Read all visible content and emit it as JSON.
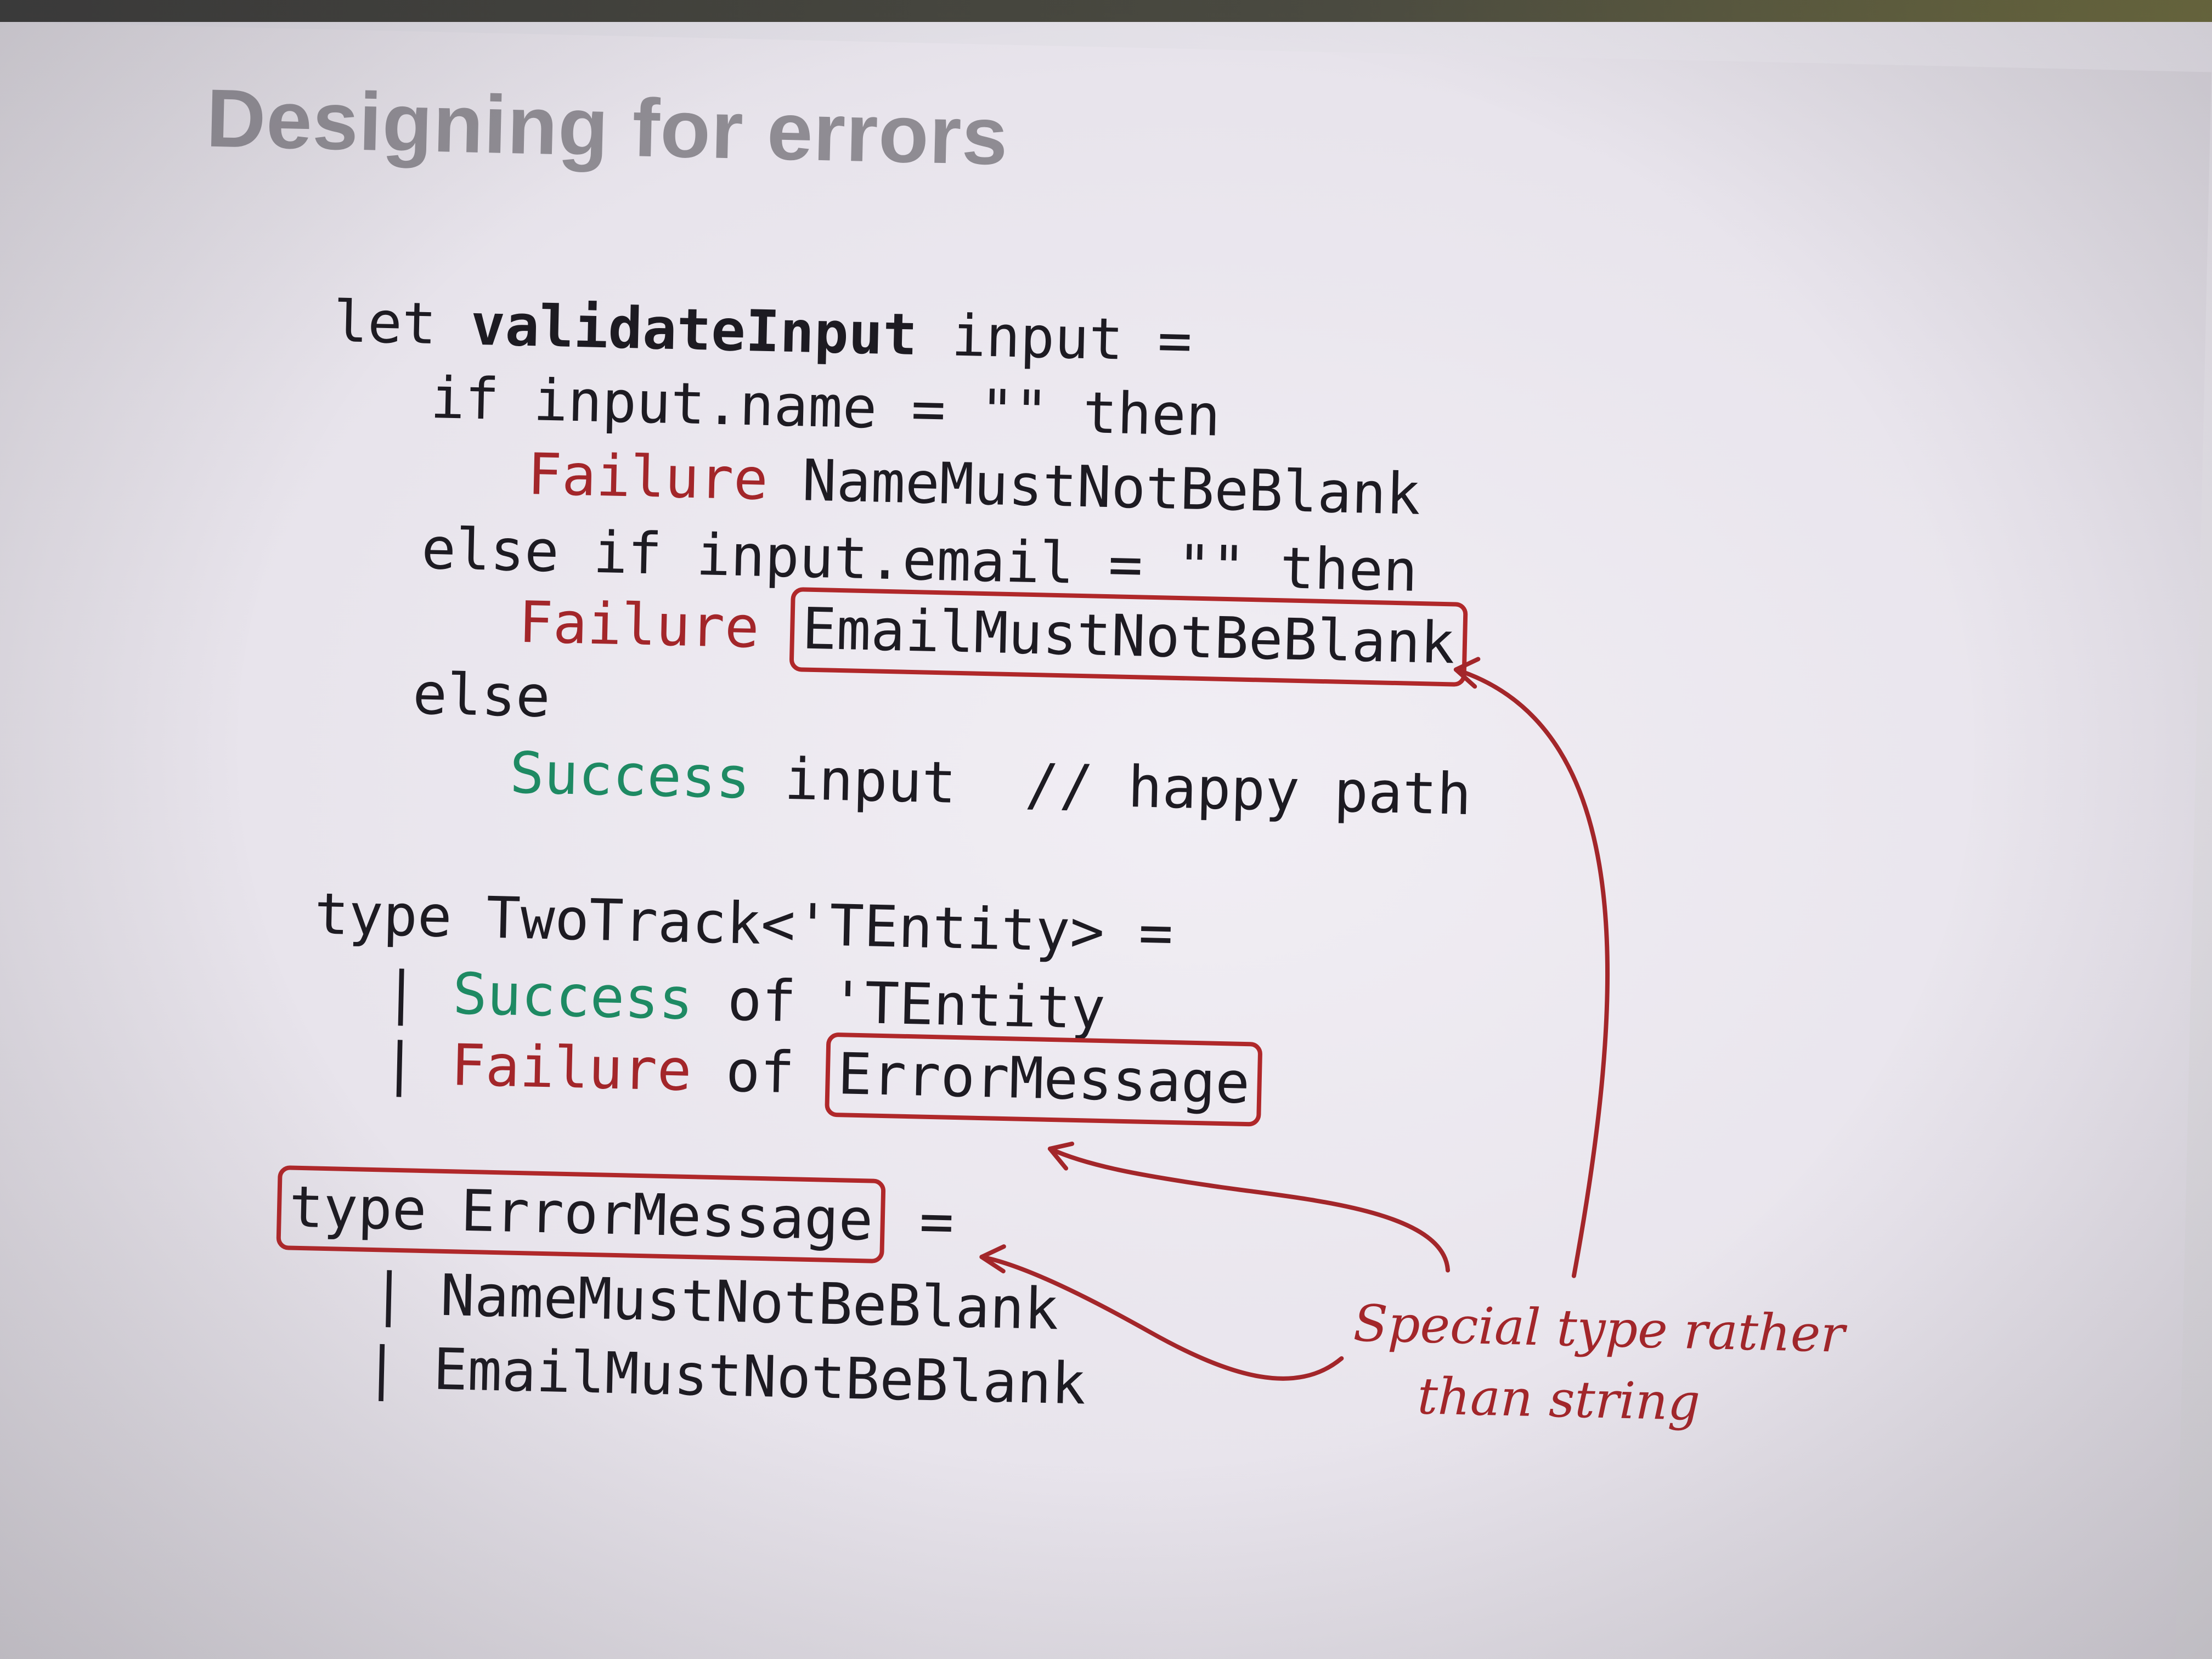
{
  "slide": {
    "title": "Designing for errors"
  },
  "code": {
    "l1": {
      "kw": "let",
      "name": "validateInput",
      "rest": "input ="
    },
    "l2": "if input.name = \"\" then",
    "l3": {
      "kw": "Failure",
      "rest": "NameMustNotBeBlank"
    },
    "l4": "else if input.email = \"\" then",
    "l5": {
      "kw": "Failure",
      "boxed": "EmailMustNotBeBlank"
    },
    "l6": "else",
    "l7": {
      "kw": "Success",
      "rest": "input  // happy path"
    },
    "l8": "type TwoTrack<'TEntity> =",
    "l9": {
      "bar": "|",
      "kw": "Success",
      "rest": "of 'TEntity"
    },
    "l10": {
      "bar": "|",
      "kw": "Failure",
      "of": "of",
      "boxed": "ErrorMessage"
    },
    "l11": {
      "boxed": "type ErrorMessage",
      "rest": "="
    },
    "l12": "| NameMustNotBeBlank",
    "l13": "| EmailMustNotBeBlank"
  },
  "annotation": {
    "line1": "Special type rather",
    "line2": "than string"
  },
  "colors": {
    "red": "#a3262a",
    "green": "#1e8a63",
    "text": "#1d1b22",
    "title": "#8f8c93"
  }
}
